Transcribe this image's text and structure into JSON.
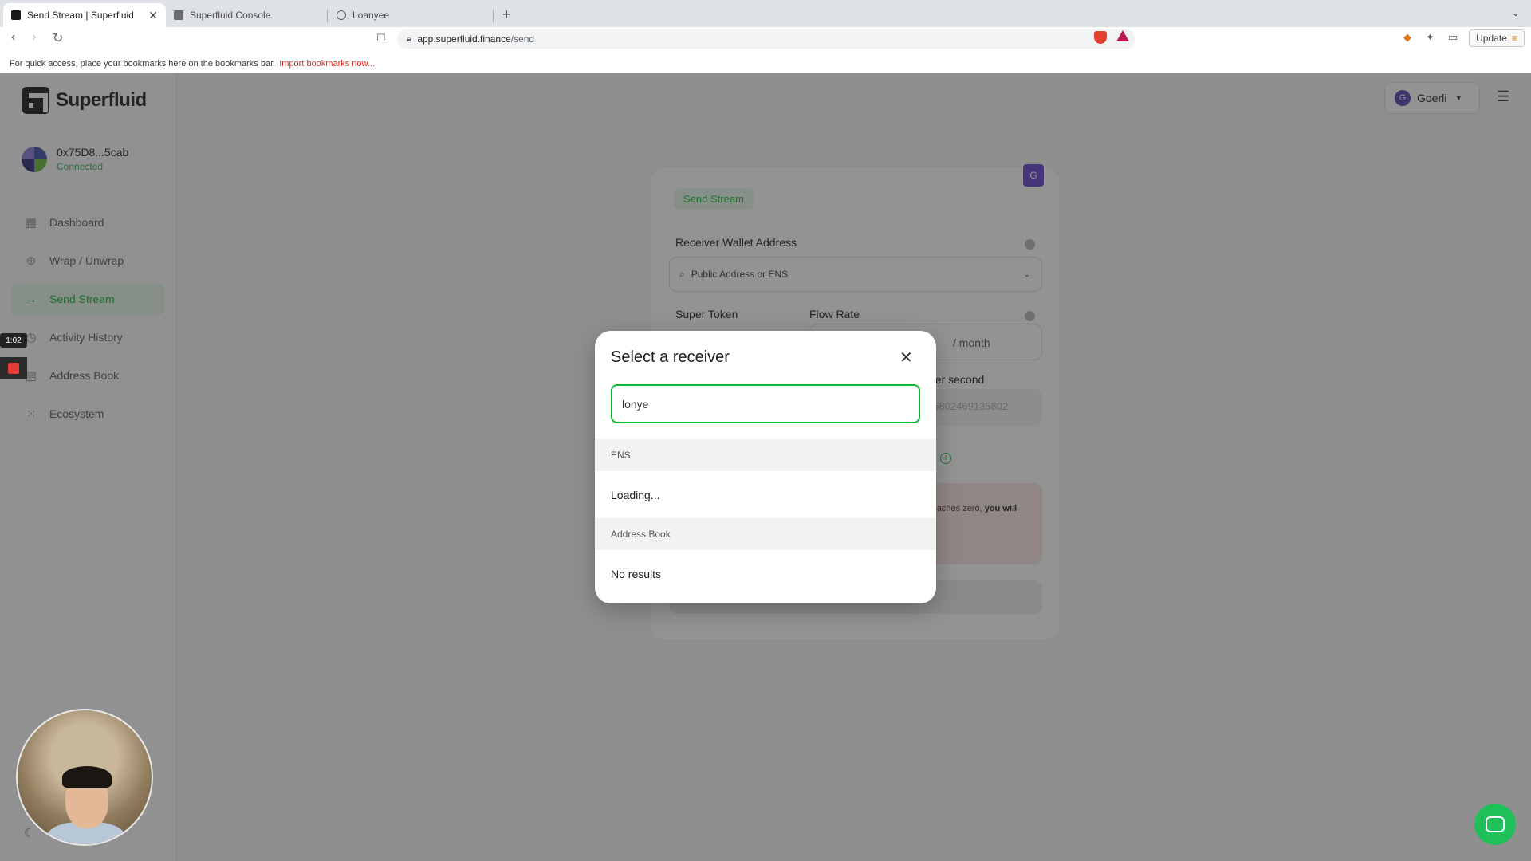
{
  "browser": {
    "tabs": [
      {
        "title": "Send Stream | Superfluid",
        "active": true
      },
      {
        "title": "Superfluid Console",
        "active": false
      },
      {
        "title": "Loanyee",
        "active": false
      }
    ],
    "url_host": "app.superfluid.finance",
    "url_path": "/send",
    "update_label": "Update",
    "bookmarks_message": "For quick access, place your bookmarks here on the bookmarks bar.",
    "bookmarks_link": "Import bookmarks now..."
  },
  "sidebar": {
    "logo_text": "Superfluid",
    "account_address": "0x75D8...5cab",
    "account_status": "Connected",
    "items": [
      {
        "label": "Dashboard",
        "icon": "dashboard-icon"
      },
      {
        "label": "Wrap / Unwrap",
        "icon": "wrap-icon"
      },
      {
        "label": "Send Stream",
        "icon": "arrow-right-icon",
        "active": true
      },
      {
        "label": "Activity History",
        "icon": "history-icon"
      },
      {
        "label": "Address Book",
        "icon": "address-book-icon"
      },
      {
        "label": "Ecosystem",
        "icon": "grid-icon"
      }
    ]
  },
  "header": {
    "network_initial": "G",
    "network_label": "Goerli"
  },
  "form": {
    "tab_label": "Send Stream",
    "receiver_label": "Receiver Wallet Address",
    "receiver_placeholder": "Public Address or ENS",
    "super_token_label": "Super Token",
    "flow_rate_label": "Flow Rate",
    "flow_unit": "/ month",
    "per_second_label": "per second",
    "per_second_value": "15802469135802",
    "warning_prefix": "reaches zero,",
    "warning_bold": "you will"
  },
  "modal": {
    "title": "Select a receiver",
    "search_value": "lonye",
    "section_ens": "ENS",
    "ens_status": "Loading...",
    "section_address_book": "Address Book",
    "address_book_status": "No results"
  },
  "recording": {
    "timer": "1:02"
  },
  "colors": {
    "accent": "#10bb35",
    "overlay": "#282828",
    "network": "#5a3fb0"
  }
}
